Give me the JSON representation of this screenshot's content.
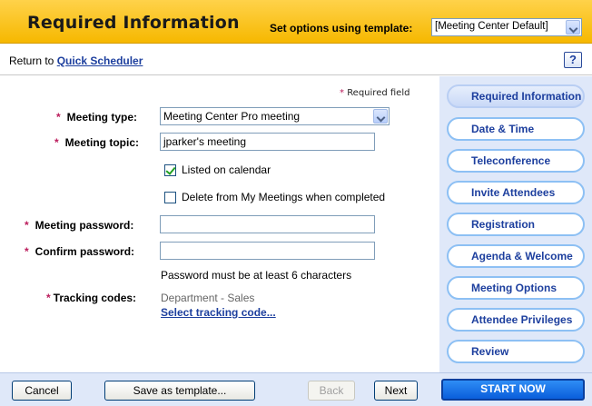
{
  "header": {
    "title": "Required Information",
    "template_label": "Set options using template:",
    "template_value": "[Meeting Center Default]"
  },
  "return_bar": {
    "prefix": "Return to",
    "link": "Quick Scheduler",
    "help_label": "?"
  },
  "form": {
    "required_note": "Required field",
    "required_marker": "*",
    "meeting_type_label": "Meeting type:",
    "meeting_type_value": "Meeting Center Pro meeting",
    "meeting_topic_label": "Meeting topic:",
    "meeting_topic_value": "jparker's meeting",
    "listed_on_calendar_label": "Listed on calendar",
    "listed_on_calendar_checked": true,
    "delete_label": "Delete from My Meetings when completed",
    "delete_checked": false,
    "password_label": "Meeting password:",
    "password_value": "",
    "confirm_label": "Confirm password:",
    "confirm_value": "",
    "password_hint": "Password must be at least 6 characters",
    "tracking_label": "Tracking codes:",
    "tracking_value": "Department - Sales",
    "tracking_link": "Select tracking code..."
  },
  "sidebar": {
    "items": [
      {
        "label": "Required Information",
        "active": true
      },
      {
        "label": "Date & Time",
        "active": false
      },
      {
        "label": "Teleconference",
        "active": false
      },
      {
        "label": "Invite Attendees",
        "active": false
      },
      {
        "label": "Registration",
        "active": false
      },
      {
        "label": "Agenda & Welcome",
        "active": false
      },
      {
        "label": "Meeting Options",
        "active": false
      },
      {
        "label": "Attendee Privileges",
        "active": false
      },
      {
        "label": "Review",
        "active": false
      }
    ]
  },
  "footer": {
    "cancel": "Cancel",
    "save_template": "Save as template...",
    "back": "Back",
    "next": "Next",
    "start": "START NOW"
  },
  "colors": {
    "header": "#f6b800",
    "link": "#1d3f9e",
    "required_star": "#bb1c5c",
    "sidebar_bg": "#dfe8f9",
    "start_button": "#0a5edb"
  }
}
